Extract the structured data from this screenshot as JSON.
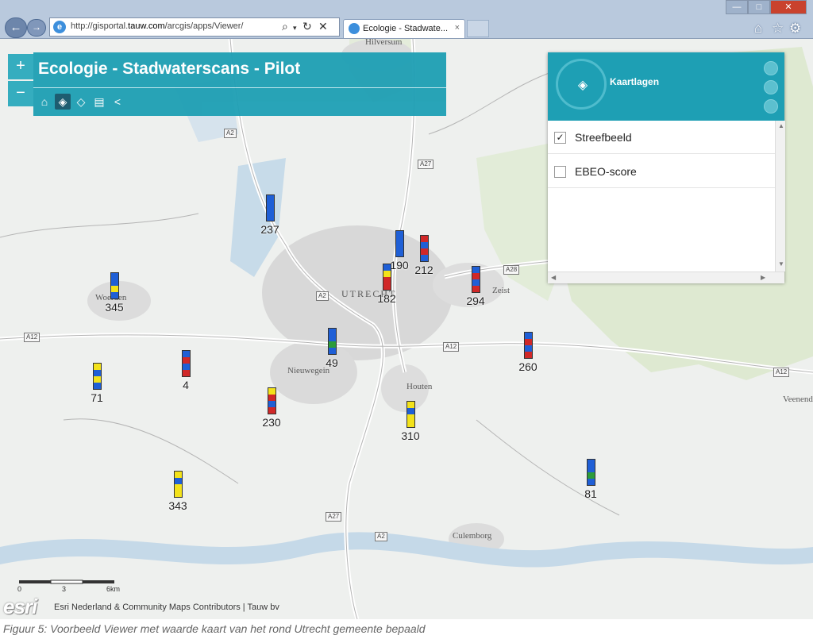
{
  "browser": {
    "url_prefix": "http://gisportal.",
    "url_domain": "tauw.com",
    "url_path": "/arcgis/apps/Viewer/",
    "tab_title": "Ecologie - Stadwate...",
    "tab_close": "×",
    "addr_icons": [
      "search-icon",
      "refresh-icon",
      "stop-icon"
    ],
    "tool_icons": [
      "home-icon",
      "favorites-star-icon",
      "settings-gear-icon"
    ]
  },
  "app": {
    "title": "Ecologie - Stadwaterscans - Pilot",
    "toolbar_icons": [
      "home-icon",
      "layers-icon",
      "basemap-icon",
      "print-icon",
      "share-icon"
    ],
    "zoom_in": "+",
    "zoom_out": "−"
  },
  "layers_panel": {
    "title": "Kaartlagen",
    "layers": [
      {
        "label": "Streefbeeld",
        "checked": true
      },
      {
        "label": "EBEO-score",
        "checked": false
      }
    ]
  },
  "map": {
    "places": [
      {
        "name": "Hilversum"
      },
      {
        "name": "UTRECHT"
      },
      {
        "name": "Woerden"
      },
      {
        "name": "Zeist"
      },
      {
        "name": "Nieuwegein"
      },
      {
        "name": "Houten"
      },
      {
        "name": "Culemborg"
      },
      {
        "name": "Veenendaal"
      }
    ],
    "roads": [
      "A2",
      "A27",
      "A28",
      "A12",
      "A12",
      "A12",
      "A2",
      "A27",
      "A2"
    ],
    "markers": [
      {
        "label": "237",
        "colors": [
          "#1f5fd6",
          "#1f5fd6",
          "#1f5fd6",
          "#1f5fd6"
        ]
      },
      {
        "label": "190",
        "colors": [
          "#1f5fd6",
          "#1f5fd6",
          "#1f5fd6",
          "#1f5fd6"
        ]
      },
      {
        "label": "212",
        "colors": [
          "#d02828",
          "#1f5fd6",
          "#d02828",
          "#1f5fd6"
        ]
      },
      {
        "label": "182",
        "colors": [
          "#1f5fd6",
          "#f3e21a",
          "#d02828",
          "#d02828"
        ]
      },
      {
        "label": "294",
        "colors": [
          "#1f5fd6",
          "#d02828",
          "#1f5fd6",
          "#d02828"
        ]
      },
      {
        "label": "345",
        "colors": [
          "#1f5fd6",
          "#1f5fd6",
          "#f3e21a",
          "#1f5fd6"
        ]
      },
      {
        "label": "49",
        "colors": [
          "#1f5fd6",
          "#1f5fd6",
          "#2c9c3a",
          "#1f5fd6"
        ]
      },
      {
        "label": "260",
        "colors": [
          "#1f5fd6",
          "#d02828",
          "#1f5fd6",
          "#d02828"
        ]
      },
      {
        "label": "71",
        "colors": [
          "#f3e21a",
          "#1f5fd6",
          "#f3e21a",
          "#1f5fd6"
        ]
      },
      {
        "label": "4",
        "colors": [
          "#1f5fd6",
          "#d02828",
          "#1f5fd6",
          "#d02828"
        ]
      },
      {
        "label": "230",
        "colors": [
          "#f3e21a",
          "#d02828",
          "#1f5fd6",
          "#d02828"
        ]
      },
      {
        "label": "310",
        "colors": [
          "#f3e21a",
          "#1f5fd6",
          "#f3e21a",
          "#f3e21a"
        ]
      },
      {
        "label": "343",
        "colors": [
          "#f3e21a",
          "#1f5fd6",
          "#f3e21a",
          "#f3e21a"
        ]
      },
      {
        "label": "81",
        "colors": [
          "#1f5fd6",
          "#1f5fd6",
          "#2c9c3a",
          "#1f5fd6"
        ]
      }
    ],
    "scale_labels": [
      "0",
      "3",
      "6km"
    ],
    "esri_logo": "esri",
    "attribution": "Esri Nederland & Community Maps Contributors | Tauw bv"
  },
  "caption": "Figuur 5: Voorbeeld   Viewer      met  waarde  kaart  van  het  rond  Utrecht  gemeente   bepaald"
}
